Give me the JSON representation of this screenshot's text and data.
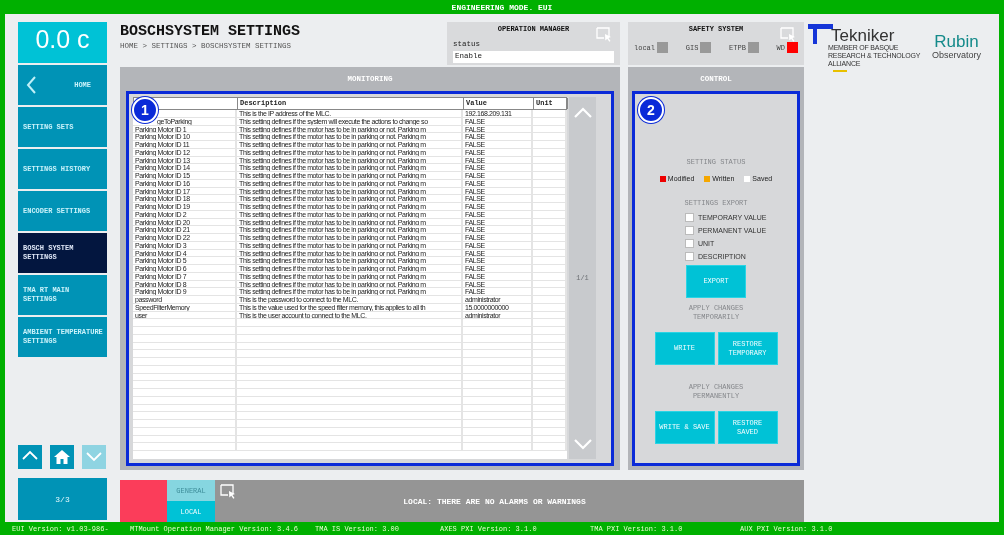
{
  "title_bar": {
    "title": "ENGINEERING MODE. EUI"
  },
  "sidebar": {
    "temperature": "0.0 c",
    "items": [
      {
        "label": "HOME",
        "kind": "back",
        "selected": false
      },
      {
        "label": "SETTING SETS",
        "kind": "page",
        "selected": false
      },
      {
        "label": "SETTINGS HISTORY",
        "kind": "page",
        "selected": false
      },
      {
        "label": "ENCODER SETTINGS",
        "kind": "page",
        "selected": false
      },
      {
        "label": "BOSCH SYSTEM SETTINGS",
        "kind": "page",
        "selected": true
      },
      {
        "label": "TMA RT MAIN SETTINGS",
        "kind": "page",
        "selected": false
      },
      {
        "label": "AMBIENT TEMPERATURE SETTINGS",
        "kind": "page",
        "selected": false
      }
    ],
    "nav_buttons": [
      {
        "kind": "up",
        "disabled": false
      },
      {
        "kind": "home",
        "disabled": false
      },
      {
        "kind": "down",
        "disabled": true
      }
    ],
    "page_indicator": "3/3"
  },
  "header": {
    "title": "BOSCHSYSTEM SETTINGS",
    "breadcrumb": "HOME > SETTINGS > BOSCHSYSTEM SETTINGS"
  },
  "operation_manager": {
    "title": "OPERATION MANAGER",
    "label": "status",
    "value": "Enable"
  },
  "safety_system": {
    "title": "SAFETY SYSTEM",
    "indicators": [
      {
        "label": "local",
        "color": "#999999"
      },
      {
        "label": "GIS",
        "color": "#999999"
      },
      {
        "label": "ETPB",
        "color": "#999999"
      },
      {
        "label": "WD",
        "color": "#ff0000"
      }
    ]
  },
  "logos": {
    "tekniker": {
      "name": "Tekniker",
      "tagline": "MEMBER OF BASQUE RESEARCH & TECHNOLOGY ALLIANCE"
    },
    "rubin": {
      "name": "Rubin",
      "subtitle": "Observatory"
    }
  },
  "monitoring": {
    "title": "MONITORING",
    "badge": "1",
    "columns": [
      "Description",
      "Value",
      "Unit"
    ],
    "rows": [
      {
        "description": "This is the IP address of the MLC.",
        "value": "192.168.209.131"
      },
      {
        "name": "geToParking",
        "description": "This setting defines if the system will execute the actions to change so",
        "value": "FALSE"
      },
      {
        "name": "Parking Motor ID 1",
        "description": "This setting defines if the motor has to be in parking or not. Parking m",
        "value": "FALSE"
      },
      {
        "name": "Parking Motor ID 10",
        "description": "This setting defines if the motor has to be in parking or not. Parking m",
        "value": "FALSE"
      },
      {
        "name": "Parking Motor ID 11",
        "description": "This setting defines if the motor has to be in parking or not. Parking m",
        "value": "FALSE"
      },
      {
        "name": "Parking Motor ID 12",
        "description": "This setting defines if the motor has to be in parking or not. Parking m",
        "value": "FALSE"
      },
      {
        "name": "Parking Motor ID 13",
        "description": "This setting defines if the motor has to be in parking or not. Parking m",
        "value": "FALSE"
      },
      {
        "name": "Parking Motor ID 14",
        "description": "This setting defines if the motor has to be in parking or not. Parking m",
        "value": "FALSE"
      },
      {
        "name": "Parking Motor ID 15",
        "description": "This setting defines if the motor has to be in parking or not. Parking m",
        "value": "FALSE"
      },
      {
        "name": "Parking Motor ID 16",
        "description": "This setting defines if the motor has to be in parking or not. Parking m",
        "value": "FALSE"
      },
      {
        "name": "Parking Motor ID 17",
        "description": "This setting defines if the motor has to be in parking or not. Parking m",
        "value": "FALSE"
      },
      {
        "name": "Parking Motor ID 18",
        "description": "This setting defines if the motor has to be in parking or not. Parking m",
        "value": "FALSE"
      },
      {
        "name": "Parking Motor ID 19",
        "description": "This setting defines if the motor has to be in parking or not. Parking m",
        "value": "FALSE"
      },
      {
        "name": "Parking Motor ID 2",
        "description": "This setting defines if the motor has to be in parking or not. Parking m",
        "value": "FALSE"
      },
      {
        "name": "Parking Motor ID 20",
        "description": "This setting defines if the motor has to be in parking or not. Parking m",
        "value": "FALSE"
      },
      {
        "name": "Parking Motor ID 21",
        "description": "This setting defines if the motor has to be in parking or not. Parking m",
        "value": "FALSE"
      },
      {
        "name": "Parking Motor ID 22",
        "description": "This setting defines if the motor has to be in parking or not. Parking m",
        "value": "FALSE"
      },
      {
        "name": "Parking Motor ID 3",
        "description": "This setting defines if the motor has to be in parking or not. Parking m",
        "value": "FALSE"
      },
      {
        "name": "Parking Motor ID 4",
        "description": "This setting defines if the motor has to be in parking or not. Parking m",
        "value": "FALSE"
      },
      {
        "name": "Parking Motor ID 5",
        "description": "This setting defines if the motor has to be in parking or not. Parking m",
        "value": "FALSE"
      },
      {
        "name": "Parking Motor ID 6",
        "description": "This setting defines if the motor has to be in parking or not. Parking m",
        "value": "FALSE"
      },
      {
        "name": "Parking Motor ID 7",
        "description": "This setting defines if the motor has to be in parking or not. Parking m",
        "value": "FALSE"
      },
      {
        "name": "Parking Motor ID 8",
        "description": "This setting defines if the motor has to be in parking or not. Parking m",
        "value": "FALSE"
      },
      {
        "name": "Parking Motor ID 9",
        "description": "This setting defines if the motor has to be in parking or not. Parking m",
        "value": "FALSE"
      },
      {
        "name": "password",
        "description": "This is the password to connect to the MLC.",
        "value": "administrator"
      },
      {
        "name": "SpeedFilterMemory",
        "description": "This is the value used for the speed filter memory, this applies to all th",
        "value": "15.0000000000"
      },
      {
        "name": "user",
        "description": "This is the user account to connect to the MLC.",
        "value": "administrator"
      }
    ],
    "pager": "1/1"
  },
  "control": {
    "title": "CONTROL",
    "badge": "2",
    "status_title": "SETTING STATUS",
    "legend": [
      {
        "label": "Modified",
        "color": "#ee0000"
      },
      {
        "label": "Written",
        "color": "#f5a700"
      },
      {
        "label": "Saved",
        "color": "#ffffff"
      }
    ],
    "export_title": "SETTINGS EXPORT",
    "export_options": [
      {
        "label": "TEMPORARY VALUE",
        "checked": false
      },
      {
        "label": "PERMANENT VALUE",
        "checked": false
      },
      {
        "label": "UNIT",
        "checked": false
      },
      {
        "label": "DESCRIPTION",
        "checked": false
      }
    ],
    "export_button": "EXPORT",
    "temporary_title": "APPLY CHANGES TEMPORARILY",
    "temporary_buttons": [
      "WRITE",
      "RESTORE TEMPORARY"
    ],
    "permanent_title": "APPLY CHANGES PERMANENTLY",
    "permanent_buttons": [
      "WRITE & SAVE",
      "RESTORE SAVED"
    ]
  },
  "alarms": {
    "tabs": [
      {
        "label": "GENERAL",
        "selected": false
      },
      {
        "label": "LOCAL",
        "selected": true
      }
    ],
    "message": "LOCAL: THERE ARE NO ALARMS OR WARNINGS"
  },
  "status_bar": [
    "EUI Version: v1.03-986-",
    "MTMount Operation Manager Version: 3.4.6",
    "TMA IS Version: 3.00",
    "AXES PXI Version: 3.1.0",
    "TMA PXI Version: 3.1.0",
    "AUX PXI Version: 3.1.0"
  ]
}
